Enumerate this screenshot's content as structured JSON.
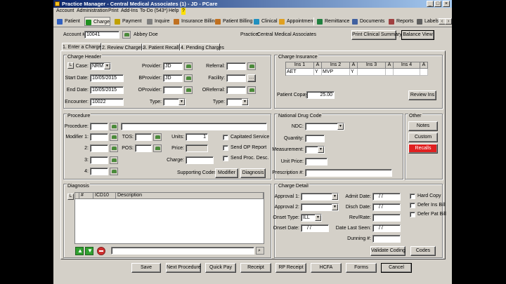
{
  "window": {
    "title": "Practice Manager - Central Medical Associates (1) - JD - PCare"
  },
  "menu": [
    "Account",
    "Administration",
    "Print",
    "Add-Ins",
    "To-Do (543*)",
    "Help",
    "?"
  ],
  "toolbar": [
    "Patient",
    "Charge",
    "Payment",
    "Inquire",
    "Insurance Billing",
    "Patient Billing",
    "Clinical",
    "Appointment",
    "Remittance",
    "Documents",
    "Reports",
    "Labels"
  ],
  "account": {
    "label": "Account #:",
    "number": "10041",
    "patient_name": "Abbey Doe",
    "practice_label": "Practice:",
    "practice": "Central Medical Associates",
    "print_summary": "Print Clinical Summary",
    "balance_view": "Balance View"
  },
  "tabs": [
    "1. Enter a Charge",
    "2. Review Charges",
    "3. Patient Recall",
    "4. Pending Charges"
  ],
  "charge_header": {
    "title": "Charge Header",
    "l_button": "L",
    "case_label": "Case:",
    "case_value": "NRM",
    "start_label": "Start Date:",
    "start_value": "10/05/2015",
    "end_label": "End Date:",
    "end_value": "10/05/2015",
    "encounter_label": "Encounter:",
    "encounter_value": "10022",
    "provider_label": "Provider:",
    "provider_value": "JD",
    "bprovider_label": "BProvider:",
    "bprovider_value": "JD",
    "oprovider_label": "OProvider:",
    "type_label": "Type:",
    "referral_label": "Referral:",
    "facility_label": "Facility:",
    "oreferral_label": "OReferral:",
    "type2_label": "Type:"
  },
  "charge_insurance": {
    "title": "Charge Insurance",
    "headers": [
      "Ins 1",
      "A",
      "Ins 2",
      "A",
      "Ins 3",
      "A",
      "Ins 4",
      "A"
    ],
    "values": [
      "AET",
      "Y",
      "MVP",
      "Y",
      "",
      "",
      "",
      ""
    ],
    "copay_label": "Patient Copay:",
    "copay_value": "25.00",
    "review_ins": "Review Ins"
  },
  "procedure": {
    "title": "Procedure",
    "procedure_label": "Procedure:",
    "modifier1_label": "Modifier 1:",
    "mod2": "2:",
    "mod3": "3:",
    "mod4": "4:",
    "tos_label": "TOS:",
    "pos_label": "POS:",
    "units_label": "Units:",
    "units_value": "1",
    "price_label": "Price:",
    "charge_label": "Charge:",
    "capitated": "Capitated Service",
    "send_op": "Send OP Report",
    "send_proc": "Send Proc. Desc.",
    "supporting_codes": "Supporting Codes:",
    "modifier_btn": "Modifier",
    "diagnosis_btn": "Diagnosis"
  },
  "drug": {
    "title": "National Drug Code",
    "ndc_label": "NDC:",
    "quantity_label": "Quantity:",
    "measurement_label": "Measurement:",
    "unit_price_label": "Unit Price:",
    "prescription_label": "Prescription #:"
  },
  "other": {
    "title": "Other",
    "notes": "Notes",
    "custom": "Custom",
    "recalls": "Recalls"
  },
  "diagnosis": {
    "title": "Diagnosis",
    "l_button": "L",
    "columns": [
      "#",
      "ICD10",
      "Description"
    ]
  },
  "charge_detail": {
    "title": "Charge Detail",
    "approval1_label": "Approval 1:",
    "approval2_label": "Approval 2:",
    "onset_type_label": "Onset Type:",
    "onset_type_value": "ILL",
    "onset_date_label": "Onset Date:",
    "onset_date_value": "/ /",
    "admit_label": "Admit Date:",
    "admit_value": "/ /",
    "disch_label": "Disch Date:",
    "disch_value": "/ /",
    "rev_rate_label": "Rev/Rate:",
    "last_seen_label": "Date Last Seen:",
    "last_seen_value": "/ /",
    "dunning_label": "Dunning #:",
    "hard_copy": "Hard Copy",
    "defer_ins": "Defer Ins Bill",
    "defer_pat": "Defer Pat Bill",
    "validate": "Validate Coding",
    "codes": "Codes"
  },
  "bottom_buttons": [
    "Save",
    "Next Procedure",
    "Quick Pay",
    "Receipt",
    "RP Receipt",
    "HCFA",
    "Forms",
    "Cancel"
  ],
  "colors": {
    "title_start": "#0a246a",
    "title_end": "#a6caf0",
    "face": "#d4d0c8",
    "recalls": "#e02020"
  }
}
